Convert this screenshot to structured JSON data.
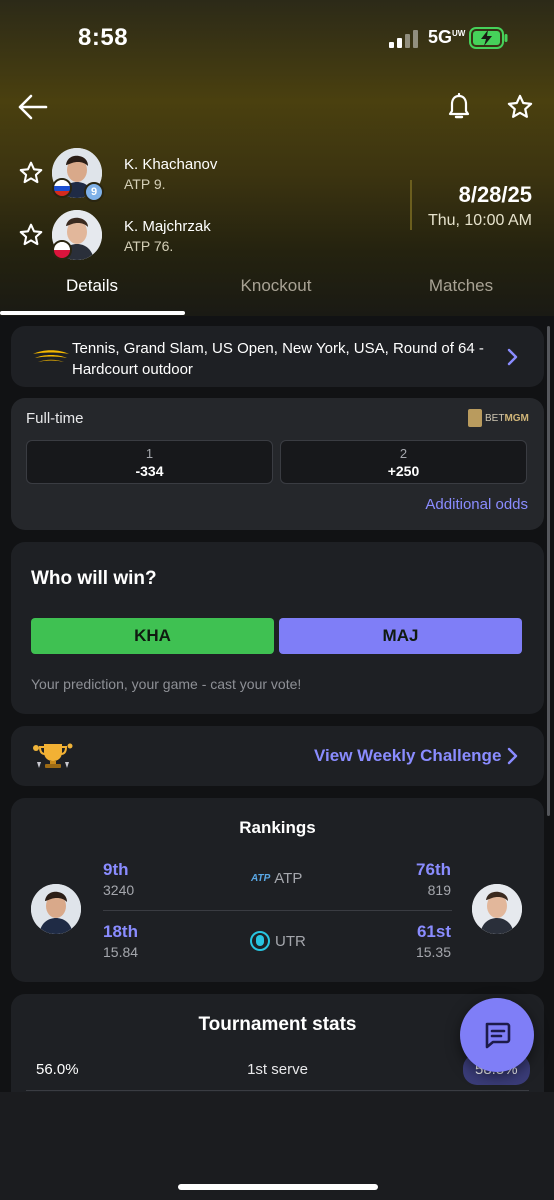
{
  "status_bar": {
    "time": "8:58",
    "network": "5G",
    "network_sup": "UW"
  },
  "players": [
    {
      "name": "K. Khachanov",
      "rank_text": "ATP 9.",
      "seed": "9",
      "flag": "russia"
    },
    {
      "name": "K. Majchrzak",
      "rank_text": "ATP 76.",
      "flag": "poland"
    }
  ],
  "match": {
    "date": "8/28/25",
    "datetime": "Thu, 10:00 AM"
  },
  "tabs": [
    "Details",
    "Knockout",
    "Matches"
  ],
  "tournament": {
    "text": "Tennis, Grand Slam, US Open, New York, USA, Round of 64 - Hardcourt outdoor"
  },
  "odds": {
    "title": "Full-time",
    "provider_prefix": "BET",
    "provider_suffix": "MGM",
    "options": [
      {
        "label": "1",
        "value": "-334"
      },
      {
        "label": "2",
        "value": "+250"
      }
    ],
    "additional": "Additional odds"
  },
  "vote": {
    "title": "Who will win?",
    "home": "KHA",
    "away": "MAJ",
    "caption": "Your prediction, your game - cast your vote!"
  },
  "challenge": {
    "label": "View Weekly Challenge"
  },
  "rankings": {
    "title": "Rankings",
    "rows": [
      {
        "home_rank": "9th",
        "home_value": "3240",
        "org_logo": "ATP",
        "org": "ATP",
        "away_rank": "76th",
        "away_value": "819"
      },
      {
        "home_rank": "18th",
        "home_value": "15.84",
        "org": "UTR",
        "away_rank": "61st",
        "away_value": "15.35"
      }
    ]
  },
  "tournament_stats": {
    "title": "Tournament stats",
    "first_row": {
      "home": "56.0%",
      "label": "1st serve",
      "away": "58.5%"
    }
  },
  "colors": {
    "accent": "#8a8cff",
    "vote_home": "#3fc152",
    "vote_away": "#7f7ef7",
    "card": "#1e2024",
    "utr": "#28c4e0"
  },
  "icons": [
    "back-arrow-icon",
    "bell-icon",
    "star-icon",
    "chevron-right-icon",
    "trophy-icon",
    "chat-icon",
    "us-open-logo-icon"
  ]
}
